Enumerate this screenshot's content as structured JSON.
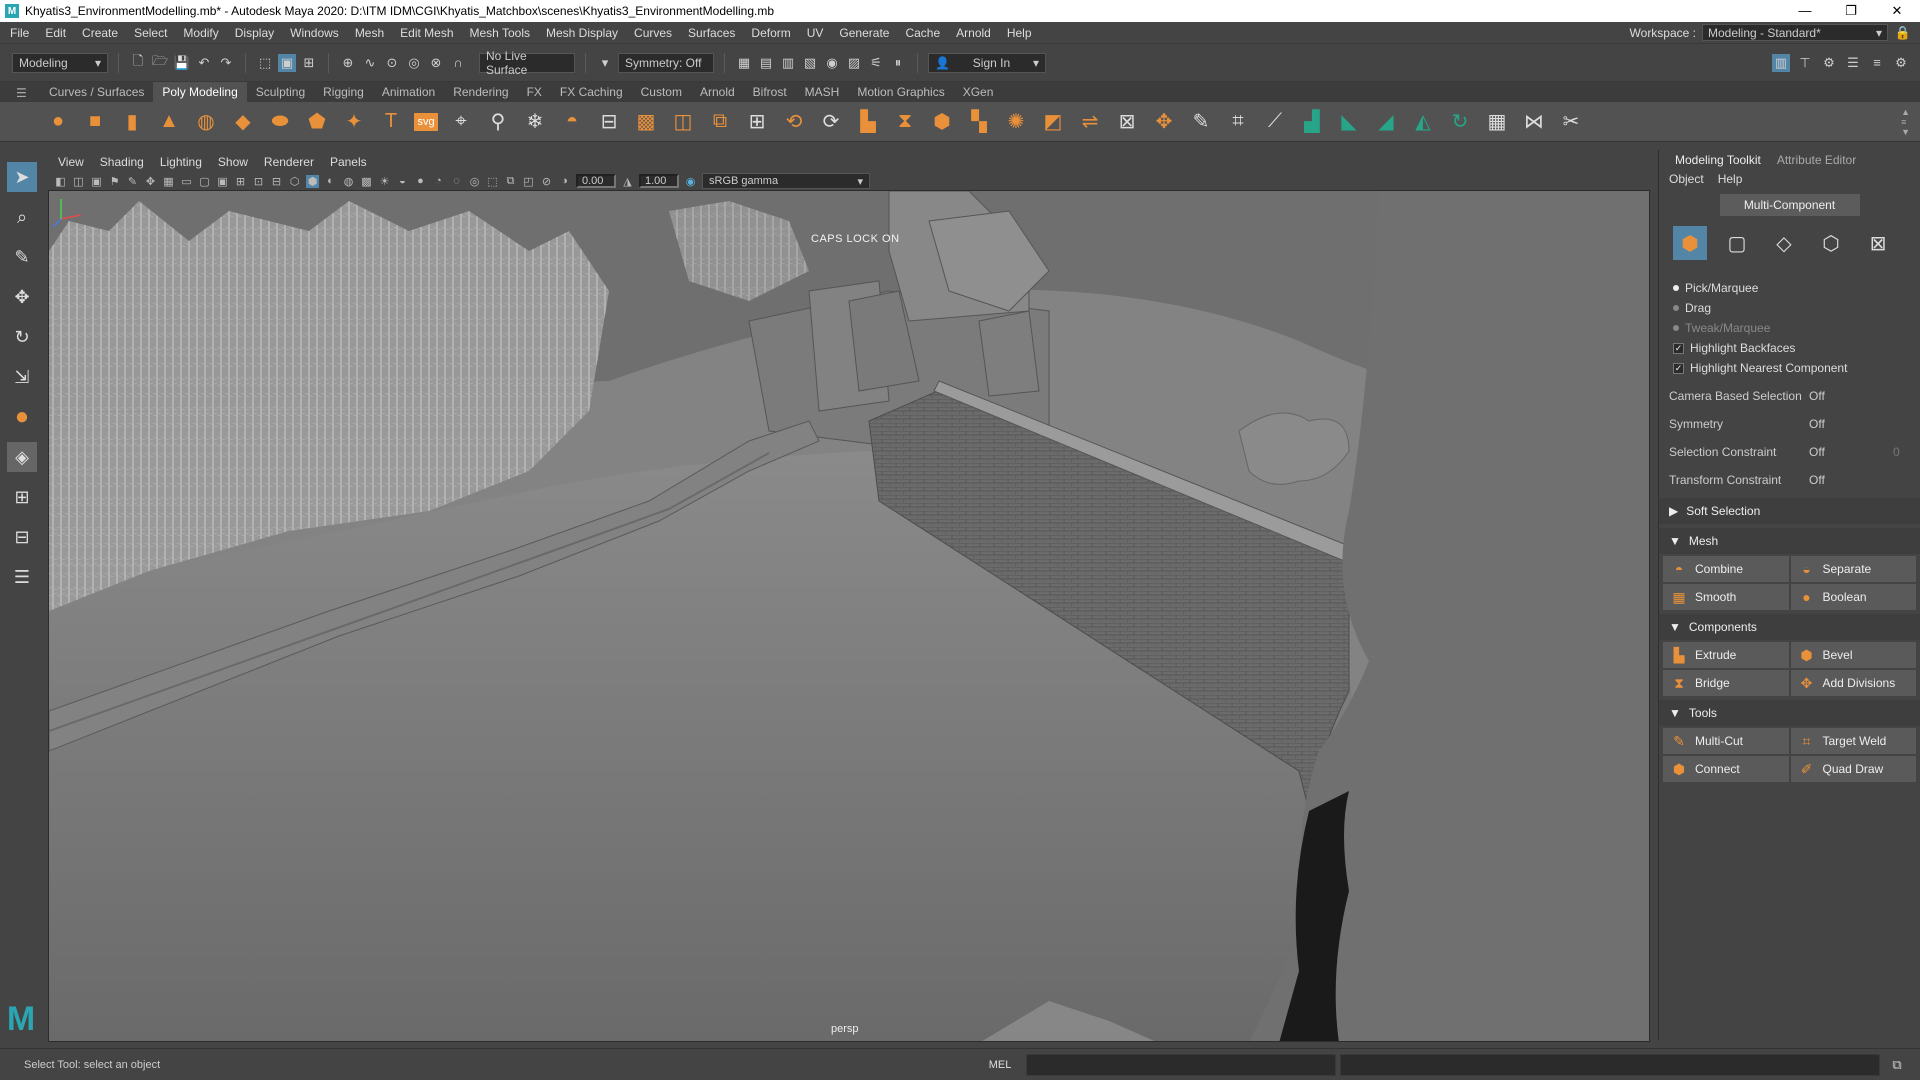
{
  "window": {
    "title": "Khyatis3_EnvironmentModelling.mb* - Autodesk Maya 2020: D:\\ITM IDM\\CGI\\Khyatis_Matchbox\\scenes\\Khyatis3_EnvironmentModelling.mb",
    "controls": [
      "—",
      "❐",
      "✕"
    ]
  },
  "menu": [
    "File",
    "Edit",
    "Create",
    "Select",
    "Modify",
    "Display",
    "Windows",
    "Mesh",
    "Edit Mesh",
    "Mesh Tools",
    "Mesh Display",
    "Curves",
    "Surfaces",
    "Deform",
    "UV",
    "Generate",
    "Cache",
    "Arnold",
    "Help"
  ],
  "workspace": {
    "label": "Workspace :",
    "value": "Modeling - Standard*"
  },
  "statusline": {
    "mode": "Modeling",
    "live_surface": "No Live Surface",
    "symmetry": "Symmetry: Off",
    "sign_in": "Sign In"
  },
  "shelf_tabs": [
    "Curves / Surfaces",
    "Poly Modeling",
    "Sculpting",
    "Rigging",
    "Animation",
    "Rendering",
    "FX",
    "FX Caching",
    "Custom",
    "Arnold",
    "Bifrost",
    "MASH",
    "Motion Graphics",
    "XGen"
  ],
  "shelf_active": "Poly Modeling",
  "viewport": {
    "menu": [
      "View",
      "Shading",
      "Lighting",
      "Show",
      "Renderer",
      "Panels"
    ],
    "exposure": "0.00",
    "gamma": "1.00",
    "colorspace": "sRGB gamma",
    "caps_lock": "CAPS LOCK ON",
    "camera": "persp"
  },
  "panel": {
    "tabs": [
      "Modeling Toolkit",
      "Attribute Editor"
    ],
    "menu": [
      "Object",
      "Help"
    ],
    "multi_component": "Multi-Component",
    "pick_marquee": "Pick/Marquee",
    "drag": "Drag",
    "tweak_marquee": "Tweak/Marquee",
    "highlight_backfaces": "Highlight Backfaces",
    "highlight_nearest": "Highlight Nearest Component",
    "camera_based_selection": {
      "label": "Camera Based Selection",
      "value": "Off"
    },
    "symmetry": {
      "label": "Symmetry",
      "value": "Off"
    },
    "selection_constraint": {
      "label": "Selection Constraint",
      "value": "Off",
      "extra": "0"
    },
    "transform_constraint": {
      "label": "Transform Constraint",
      "value": "Off"
    },
    "soft_selection": "Soft Selection",
    "mesh": {
      "title": "Mesh",
      "buttons": [
        "Combine",
        "Separate",
        "Smooth",
        "Boolean"
      ]
    },
    "components": {
      "title": "Components",
      "buttons": [
        "Extrude",
        "Bevel",
        "Bridge",
        "Add Divisions"
      ]
    },
    "tools": {
      "title": "Tools",
      "buttons": [
        "Multi-Cut",
        "Target Weld",
        "Connect",
        "Quad Draw"
      ]
    }
  },
  "helpline": {
    "text": "Select Tool: select an object",
    "mel": "MEL"
  },
  "colors": {
    "accent_blue": "#5285a6",
    "maya_orange": "#e9913a",
    "maya_teal": "#2aa6b3"
  }
}
